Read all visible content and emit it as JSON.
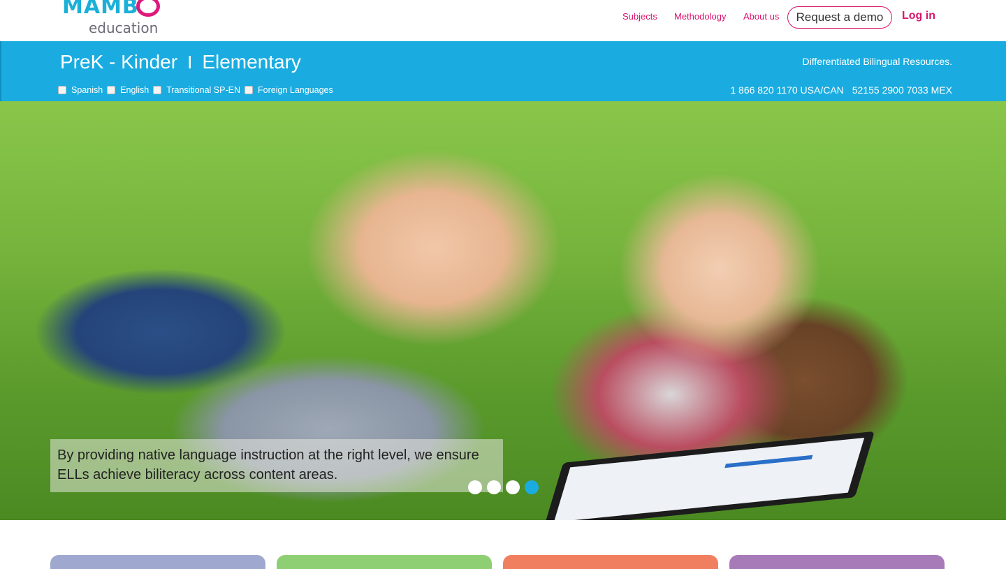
{
  "header": {
    "logo_wordmark": "MAMB",
    "logo_subtitle": "education",
    "nav": {
      "subjects": "Subjects",
      "methodology": "Methodology",
      "about": "About us",
      "demo": "Request a demo",
      "login": "Log in"
    }
  },
  "band": {
    "levels": [
      "PreK - Kinder",
      "Elementary"
    ],
    "separator": "I",
    "tagline": "Differentiated Bilingual Resources.",
    "languages": [
      "Spanish",
      "English",
      "Transitional SP-EN",
      "Foreign Languages"
    ],
    "phones": [
      "1 866 820 1170 USA/CAN",
      "52155 2900 7033 MEX"
    ]
  },
  "hero": {
    "caption": "By providing native language instruction at the right level, we ensure ELLs achieve biliteracy across content areas.",
    "slide_count": 4,
    "active_slide": 4
  },
  "colors": {
    "brand_blue": "#1aace0",
    "brand_pink": "#d8156e",
    "card_colors": [
      "#9fa9d0",
      "#8ecf73",
      "#f07f60",
      "#a77ab8"
    ]
  }
}
